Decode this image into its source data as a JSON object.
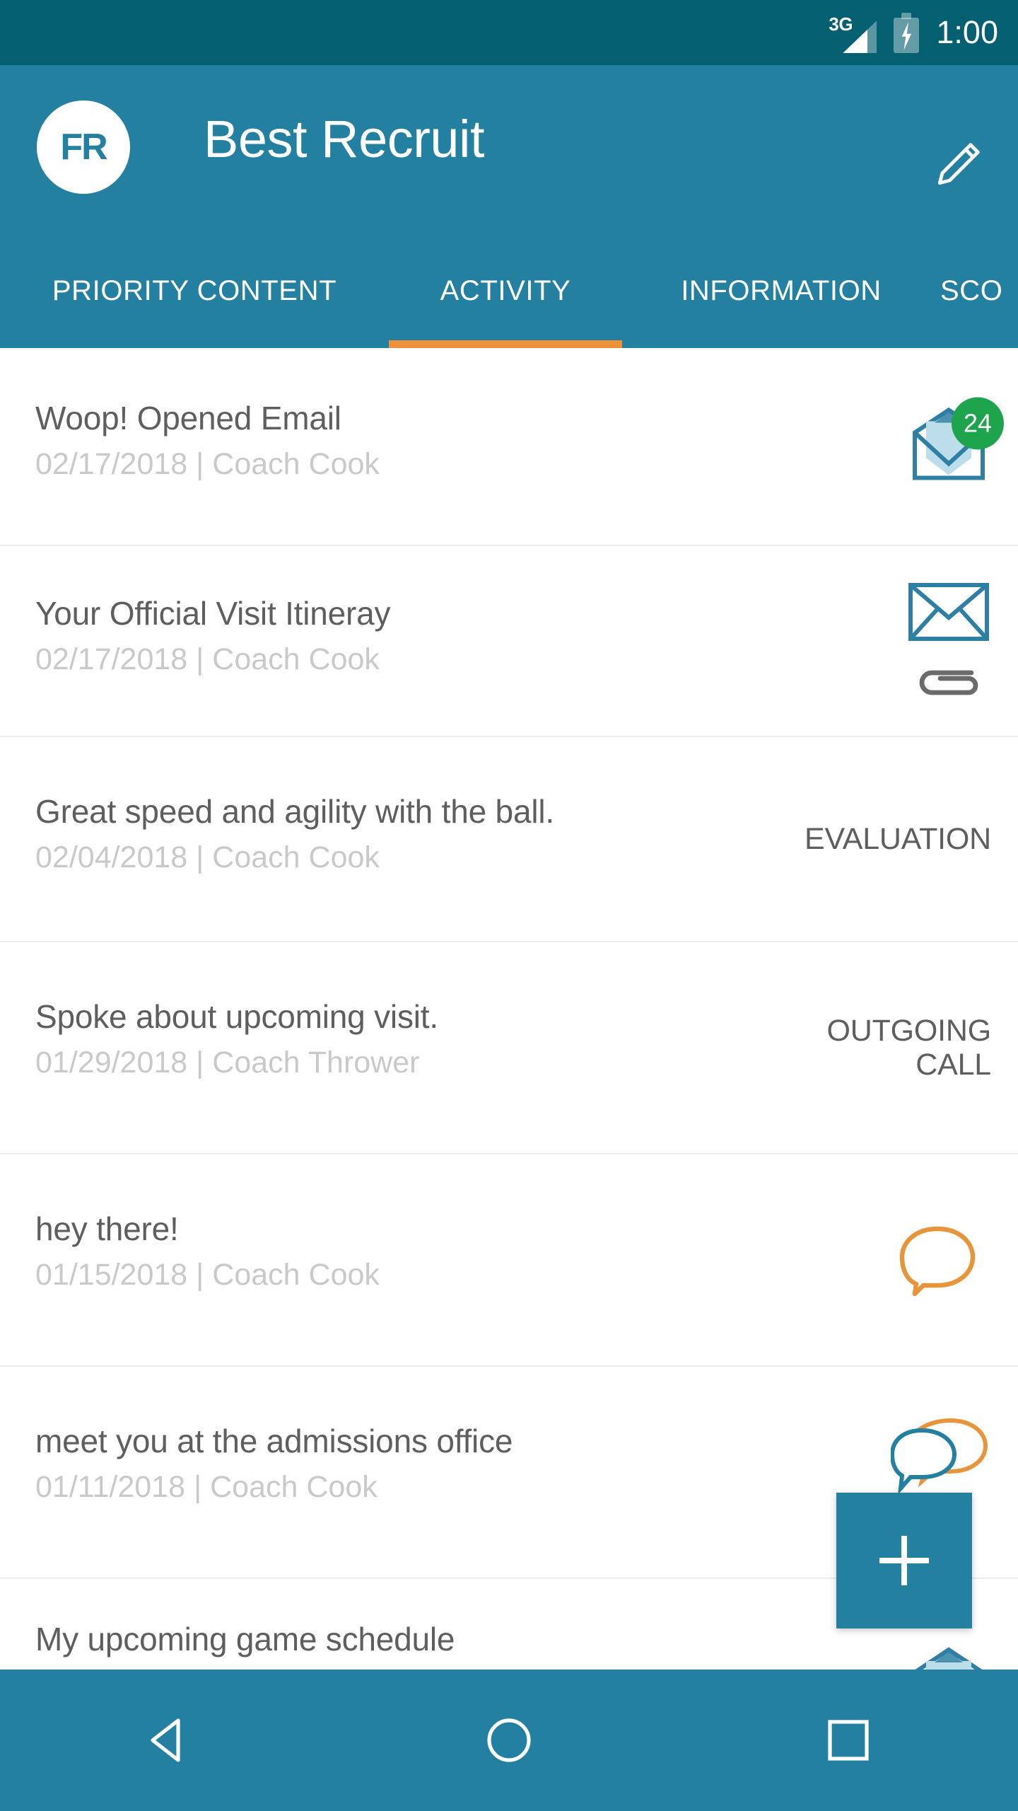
{
  "status_bar": {
    "network_icon": "3g-signal-icon",
    "network_label": "3G",
    "battery_icon": "battery-charging-icon",
    "time": "1:00"
  },
  "app_bar": {
    "logo_icon": "fr-logo-icon",
    "logo_text": "FR",
    "title": "Best Recruit",
    "edit_icon": "pencil-icon"
  },
  "tabs": {
    "active_index": 1,
    "active_color": "#f0913a",
    "items": [
      {
        "label": "PRIORITY CONTENT"
      },
      {
        "label": "ACTIVITY"
      },
      {
        "label": "INFORMATION"
      },
      {
        "label": "SCO"
      }
    ]
  },
  "activity_list": [
    {
      "title": "Woop! Opened Email",
      "date": "02/17/2018",
      "coach": "Coach Cook",
      "separator": "|",
      "icon": "open-envelope-icon",
      "badge_count": "24",
      "badge_color": "#1fa44e"
    },
    {
      "title": "Your Official Visit Itineray",
      "date": "02/17/2018",
      "coach": "Coach Cook",
      "separator": "|",
      "icon": "closed-envelope-icon",
      "secondary_icon": "paperclip-icon"
    },
    {
      "title": "Great speed and agility with the ball.",
      "date": "02/04/2018",
      "coach": "Coach Cook",
      "separator": "|",
      "type_label": "EVALUATION"
    },
    {
      "title": "Spoke about upcoming visit.",
      "date": "01/29/2018",
      "coach": "Coach Thrower",
      "separator": "|",
      "type_label": "OUTGOING\nCALL"
    },
    {
      "title": "hey there!",
      "date": "01/15/2018",
      "coach": "Coach Cook",
      "separator": "|",
      "icon": "speech-bubble-icon",
      "icon_color": "#e8943b"
    },
    {
      "title": "meet you at the admissions office",
      "date": "01/11/2018",
      "coach": "Coach Cook",
      "separator": "|",
      "icon": "double-speech-bubble-icon",
      "icon_color": "#2380a0",
      "icon_color_secondary": "#e8943b"
    },
    {
      "title": "My upcoming game schedule",
      "icon": "open-envelope-icon"
    }
  ],
  "fab": {
    "icon": "plus-icon",
    "color": "#2380a0"
  },
  "nav_bar": {
    "back_icon": "back-triangle-icon",
    "home_icon": "home-circle-icon",
    "recents_icon": "recents-square-icon"
  },
  "theme": {
    "status_bar_bg": "#046070",
    "app_bar_bg": "#2380a0",
    "accent": "#f0913a",
    "title_text": "#5e5e5e",
    "sub_text": "#c9c9c9",
    "divider": "#eceded"
  }
}
